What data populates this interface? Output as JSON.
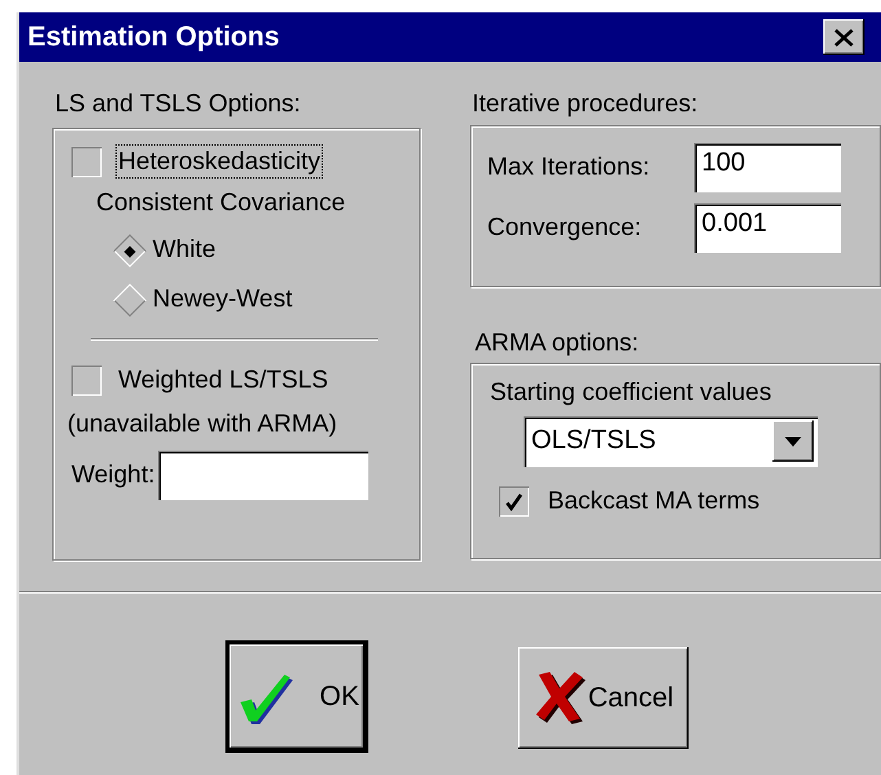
{
  "window": {
    "title": "Estimation Options"
  },
  "ls_tsls": {
    "title": "LS and TSLS Options:",
    "heteroskedasticity": {
      "label": "Heteroskedasticity",
      "checked": false,
      "focused": true
    },
    "caption": "Consistent Covariance",
    "methods": [
      {
        "label": "White",
        "selected": true
      },
      {
        "label": "Newey-West",
        "selected": false
      }
    ],
    "weighted": {
      "label": "Weighted LS/TSLS",
      "checked": false
    },
    "note": "(unavailable with ARMA)",
    "weight": {
      "label": "Weight:"
    }
  },
  "iterative": {
    "title": "Iterative procedures:",
    "fields": [
      {
        "label": "Max Iterations:",
        "value": "100"
      },
      {
        "label": "Convergence:",
        "value": "0.001"
      }
    ]
  },
  "arma": {
    "title": "ARMA options:",
    "starting_label": "Starting coefficient values",
    "starting_value": "OLS/TSLS",
    "backcast": {
      "label": "Backcast MA terms",
      "checked": true
    }
  },
  "buttons": [
    {
      "label": "OK",
      "kind": "ok",
      "default": true
    },
    {
      "label": "Cancel",
      "kind": "cancel",
      "default": false
    }
  ]
}
